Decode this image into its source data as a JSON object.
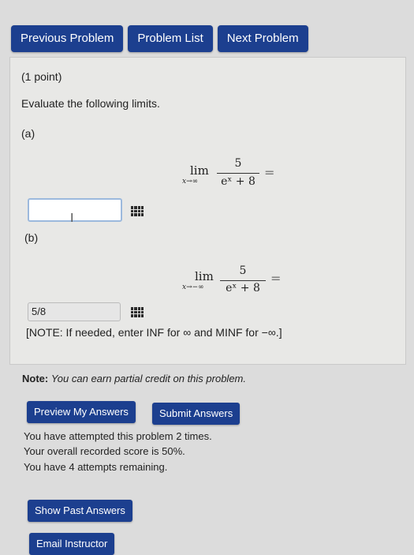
{
  "nav": {
    "previous": "Previous Problem",
    "list": "Problem List",
    "next": "Next Problem"
  },
  "problem": {
    "points": "(1 point)",
    "instructions": "Evaluate the following limits.",
    "part_a": {
      "label": "(a)",
      "lim": "lim",
      "sub": "x→∞",
      "numerator": "5",
      "denominator": "eˣ + 8",
      "eq": "=",
      "answer": ""
    },
    "part_b": {
      "label": "(b)",
      "lim": "lim",
      "sub": "x→−∞",
      "numerator": "5",
      "denominator": "eˣ + 8",
      "eq": "=",
      "answer": "5/8"
    },
    "note": "[NOTE: If needed, enter INF for ∞ and MINF for −∞.]"
  },
  "credit": {
    "label": "Note:",
    "text": "You can earn partial credit on this problem."
  },
  "buttons": {
    "preview": "Preview My Answers",
    "submit": "Submit Answers",
    "show_past": "Show Past Answers",
    "email": "Email Instructor"
  },
  "status": {
    "attempts": "You have attempted this problem 2 times.",
    "score": "Your overall recorded score is 50%.",
    "remaining": "You have 4 attempts remaining."
  }
}
